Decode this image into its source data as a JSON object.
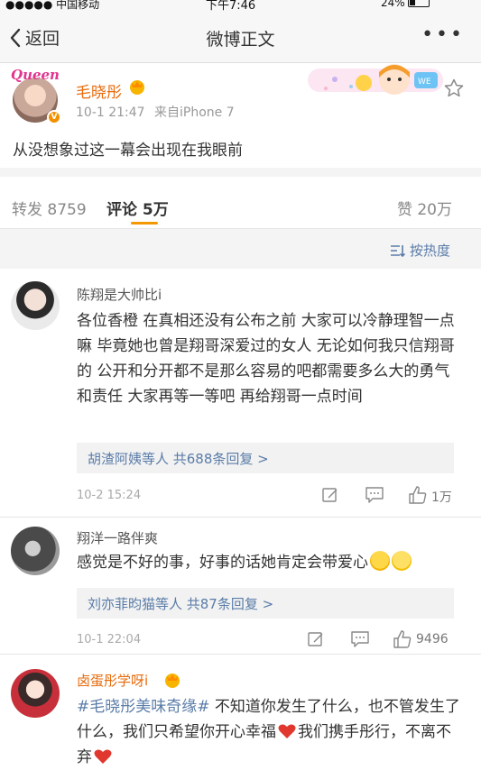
{
  "status_bar": {
    "carrier": "●●●●● 中国移动",
    "time": "下午7:46",
    "battery": "24%"
  },
  "nav": {
    "back_label": "返回",
    "title": "微博正文",
    "more_label": "•••"
  },
  "post": {
    "avatar_badge_text": "Queen",
    "author": "毛晓彤",
    "time": "10-1 21:47",
    "source": "来自iPhone 7",
    "text": "从没想象过这一幕会出现在我眼前"
  },
  "tabs": {
    "repost": "转发 8759",
    "comments": "评论 5万",
    "likes": "赞 20万"
  },
  "sort_label": "按热度",
  "comments": [
    {
      "name": "陈翔是大帅比i",
      "text": "各位香橙 在真相还没有公布之前 大家可以冷静理智一点嘛 毕竟她也曾是翔哥深爱过的女人 无论如何我只信翔哥的 公开和分开都不是那么容易的吧都需要多么大的勇气和责任 大家再等一等吧 再给翔哥一点时间",
      "replies": "胡渣阿姨等人 共688条回复 >",
      "time": "10-2 15:24",
      "likes": "1万"
    },
    {
      "name": "翔洋一路伴爽",
      "text": "感觉是不好的事，好事的话她肯定会带爱心",
      "replies": "刘亦菲昀猫等人 共87条回复 >",
      "time": "10-1 22:04",
      "likes": "9496"
    },
    {
      "name": "卤蛋彤学呀i",
      "tag": "#毛晓彤美味奇缘#",
      "text": " 不知道你发生了什么，也不管发生了什么，我们只希望你开心幸福",
      "text2": "我们携手彤行，不离不弃"
    }
  ],
  "colors": {
    "accent": "#f39800",
    "link": "#5a7ca8",
    "author": "#e86b0c",
    "heart": "#e0382f"
  }
}
